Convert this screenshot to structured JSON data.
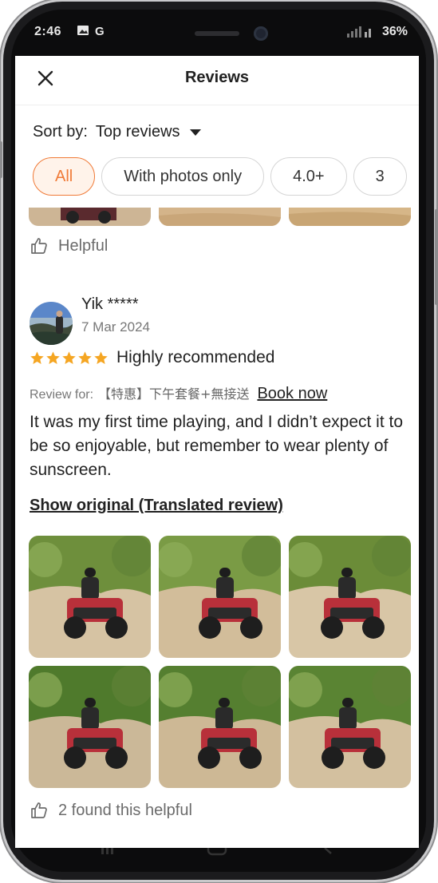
{
  "status": {
    "time": "2:46",
    "battery": "36%"
  },
  "header": {
    "title": "Reviews"
  },
  "sort": {
    "label": "Sort by:",
    "value": "Top reviews"
  },
  "filters": [
    "All",
    "With photos only",
    "4.0+",
    "3"
  ],
  "previous_review": {
    "helpful_label": "Helpful"
  },
  "review": {
    "username": "Yik *****",
    "date": "7 Mar 2024",
    "stars": 5,
    "rating_text": "Highly recommended",
    "review_for_label": "Review for:",
    "product": "【特惠】下午套餐+無接送",
    "book_now": "Book now",
    "body": "It was my first time playing, and I didn’t expect it to be so enjoyable, but remember to wear plenty of sunscreen.",
    "show_original": "Show original (Translated review)",
    "helpful_label": "2 found this helpful",
    "photo_count": 6
  },
  "colors": {
    "accent": "#f07a37",
    "star": "#f5a623"
  }
}
